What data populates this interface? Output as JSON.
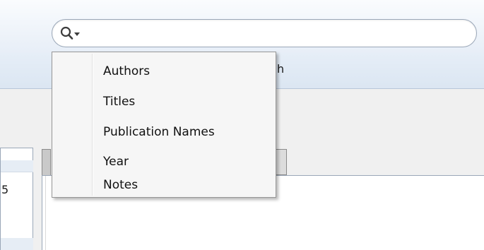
{
  "colors": {
    "menu_background": "#f6f6f6",
    "toolbar_gradient_top": "#fafcfe",
    "toolbar_gradient_bottom": "#dbe6f2"
  },
  "toolbar": {
    "partial_label": "h"
  },
  "search": {
    "value": "",
    "placeholder": "",
    "icon": "search-icon",
    "dropdown_icon": "chevron-down-icon"
  },
  "menu": {
    "items": [
      {
        "label": "Authors"
      },
      {
        "label": "Titles"
      },
      {
        "label": "Publication Names"
      },
      {
        "label": "Year"
      },
      {
        "label": "Notes"
      }
    ]
  },
  "left_pane": {
    "partial_value": "5"
  }
}
